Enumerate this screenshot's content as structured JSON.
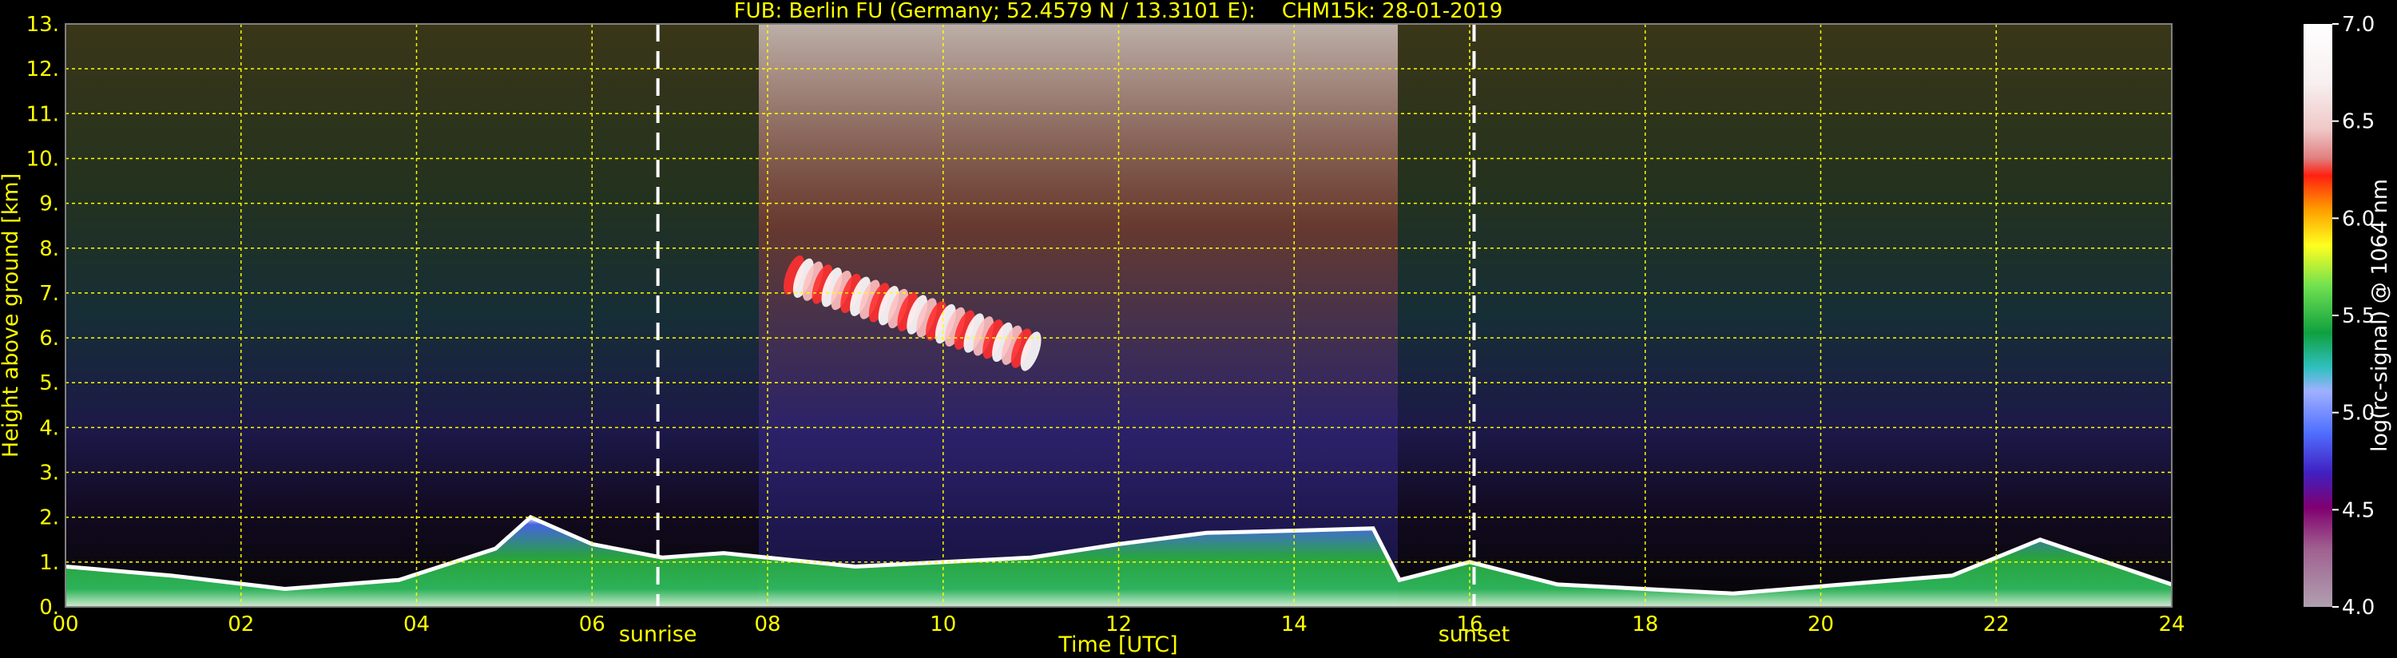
{
  "title": "FUB: Berlin FU (Germany; 52.4579 N / 13.3101 E):    CHM15k: 28-01-2019",
  "chart_data": {
    "type": "heatmap",
    "title": "FUB: Berlin FU (Germany; 52.4579 N / 13.3101 E):    CHM15k: 28-01-2019",
    "xlabel": "Time [UTC]",
    "ylabel": "Height above ground [km]",
    "xlim": [
      0,
      24
    ],
    "ylim": [
      0,
      13
    ],
    "x_ticks": [
      "00",
      "02",
      "04",
      "06",
      "08",
      "10",
      "12",
      "14",
      "16",
      "18",
      "20",
      "22",
      "24"
    ],
    "y_ticks": [
      "0.",
      "1.",
      "2.",
      "3.",
      "4.",
      "5.",
      "6.",
      "7.",
      "8.",
      "9.",
      "10.",
      "11.",
      "12.",
      "13."
    ],
    "grid": true,
    "colorbar": {
      "label": "log(rc-signal) @ 1064 nm",
      "range": [
        4.0,
        7.0
      ],
      "ticks": [
        "4.0",
        "4.5",
        "5.0",
        "5.5",
        "6.0",
        "6.5",
        "7.0"
      ]
    },
    "markers": [
      {
        "label": "sunrise",
        "time_utc": 6.75
      },
      {
        "label": "sunset",
        "time_utc": 16.05
      }
    ],
    "boundary_layer_top_km": [
      [
        0,
        0.9
      ],
      [
        1.2,
        0.7
      ],
      [
        2.5,
        0.4
      ],
      [
        3.8,
        0.6
      ],
      [
        4.9,
        1.3
      ],
      [
        5.3,
        2.0
      ],
      [
        6.0,
        1.4
      ],
      [
        6.8,
        1.1
      ],
      [
        7.5,
        1.2
      ],
      [
        9.0,
        0.9
      ],
      [
        11.0,
        1.1
      ],
      [
        12.0,
        1.4
      ],
      [
        13.0,
        1.65
      ],
      [
        14.0,
        1.7
      ],
      [
        14.9,
        1.75
      ],
      [
        15.2,
        0.6
      ],
      [
        16.0,
        1.0
      ],
      [
        17.0,
        0.5
      ],
      [
        19.0,
        0.3
      ],
      [
        21.5,
        0.7
      ],
      [
        22.5,
        1.5
      ],
      [
        24.0,
        0.5
      ]
    ],
    "cloud_layers": [
      {
        "time_utc": [
          8.3,
          11.0
        ],
        "height_km": [
          5.8,
          7.8
        ],
        "signal": "6.0-7.0"
      }
    ]
  }
}
